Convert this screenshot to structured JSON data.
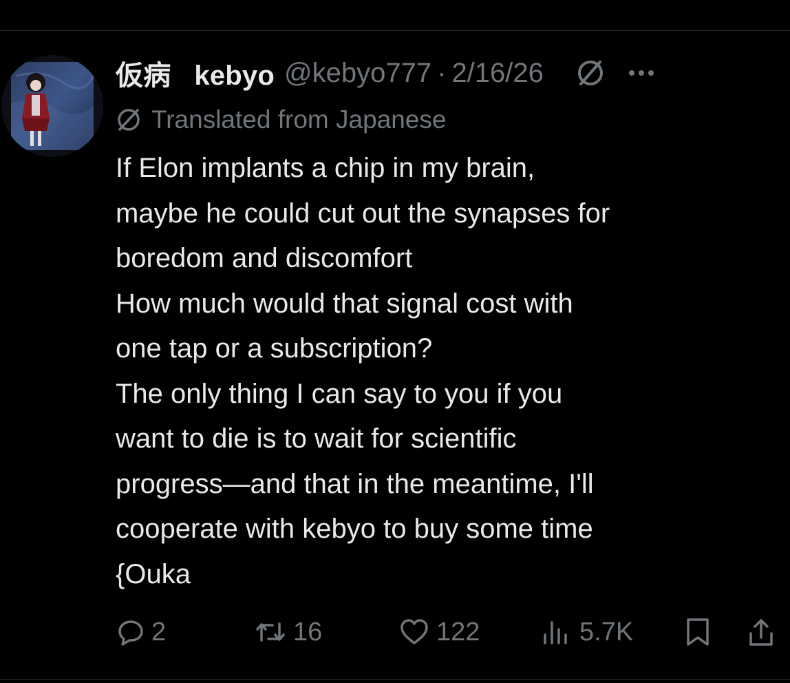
{
  "author": {
    "display_name_jp": "仮病",
    "display_name": "kebyo",
    "handle": "@kebyo777",
    "separator": "·",
    "date": "2/16/26",
    "avatar": "avatar-doll-image"
  },
  "translation": {
    "label": "Translated from Japanese",
    "icon": "translate-icon"
  },
  "tweet": {
    "lines": [
      "If Elon implants a chip in my brain,",
      "maybe he could cut out the synapses for",
      "boredom and discomfort",
      "How much would that signal cost with",
      "one tap or a subscription?",
      "The only thing I can say to you if you",
      "want to die is to wait for scientific",
      "progress—and that in the meantime, I'll",
      "cooperate with kebyo to buy some time",
      "{Ouka"
    ]
  },
  "actions": {
    "replies": "2",
    "reposts": "16",
    "likes": "122",
    "views": "5.7K",
    "icons": [
      "reply-icon",
      "repost-icon",
      "like-icon",
      "views-icon",
      "bookmark-icon",
      "share-icon"
    ]
  },
  "colors": {
    "background": "#000000",
    "text": "#e7e9ea",
    "secondary": "#71767b",
    "divider": "#2f3336"
  }
}
